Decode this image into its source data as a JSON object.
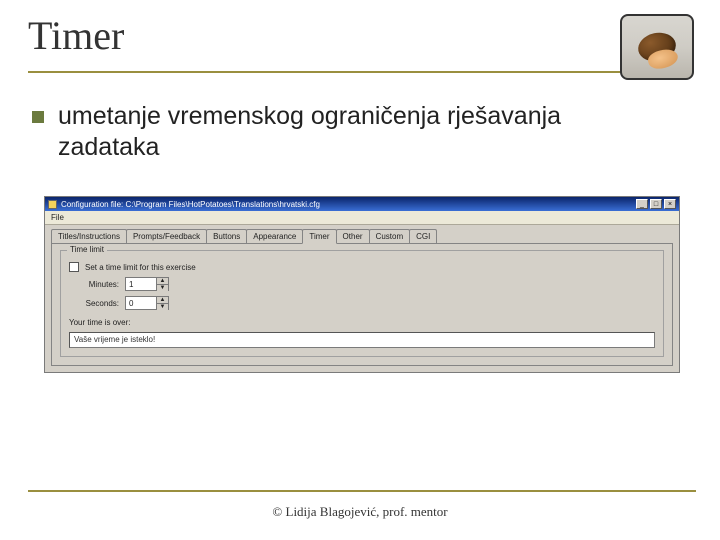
{
  "title": "Timer",
  "bullet_text": "umetanje vremenskog ograničenja rješavanja zadataka",
  "footer": "© Lidija Blagojević, prof. mentor",
  "shot": {
    "window_title": "Configuration file: C:\\Program Files\\HotPotatoes\\Translations\\hrvatski.cfg",
    "menu": "File",
    "tabs": [
      "Titles/Instructions",
      "Prompts/Feedback",
      "Buttons",
      "Appearance",
      "Timer",
      "Other",
      "Custom",
      "CGI"
    ],
    "active_tab_index": 4,
    "group_title": "Time limit",
    "checkbox_label": "Set a time limit for this exercise",
    "minutes_label": "Minutes:",
    "minutes_value": "1",
    "seconds_label": "Seconds:",
    "seconds_value": "0",
    "timeup_label": "Your time is over:",
    "timeup_value": "Vaše vrijeme je isteklo!"
  }
}
